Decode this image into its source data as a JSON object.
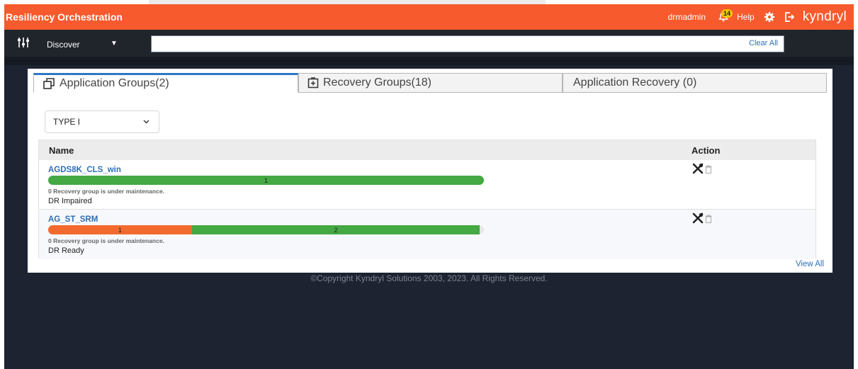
{
  "header": {
    "title": "Resiliency Orchestration",
    "user": "drmadmin",
    "notification_count": "14",
    "help_label": "Help",
    "logo_text": "kyndryl"
  },
  "filterbar": {
    "view_label": "Discover",
    "clear_all_label": "Clear All"
  },
  "tabs": [
    {
      "label": "Application Groups(2)",
      "active": true
    },
    {
      "label": "Recovery Groups(18)",
      "active": false
    },
    {
      "label": "Application Recovery (0)",
      "active": false
    }
  ],
  "type_filter": {
    "selected": "TYPE I"
  },
  "table": {
    "columns": [
      "Name",
      "Action"
    ],
    "rows": [
      {
        "name": "AGDS8K_CLS_win",
        "segments": [
          {
            "value": "1",
            "color": "#44a843",
            "fraction": 1.0
          }
        ],
        "maintenance_note": "0 Recovery group is under maintenance.",
        "status": "DR Impaired"
      },
      {
        "name": "AG_ST_SRM",
        "segments": [
          {
            "value": "1",
            "color": "#f26a2e",
            "fraction": 0.33
          },
          {
            "value": "2",
            "color": "#44a843",
            "fraction": 0.66
          }
        ],
        "maintenance_note": "0 Recovery group is under maintenance.",
        "status": "DR Ready"
      }
    ],
    "view_all_label": "View All"
  },
  "footer": {
    "copyright": "©Copyright Kyndryl Solutions 2003, 2023. All Rights Reserved."
  },
  "colors": {
    "brand": "#f75a2d",
    "ok": "#44a843",
    "warn": "#f26a2e",
    "link": "#2d6fb8",
    "badge": "#f5c400",
    "tab_active": "#2d78c6"
  },
  "icons": [
    "filter-sliders-icon",
    "caret-down-icon",
    "bell-icon",
    "gear-icon",
    "logout-icon",
    "copy-icon",
    "plus-box-icon",
    "chevron-down-icon",
    "tools-icon",
    "trash-icon"
  ]
}
